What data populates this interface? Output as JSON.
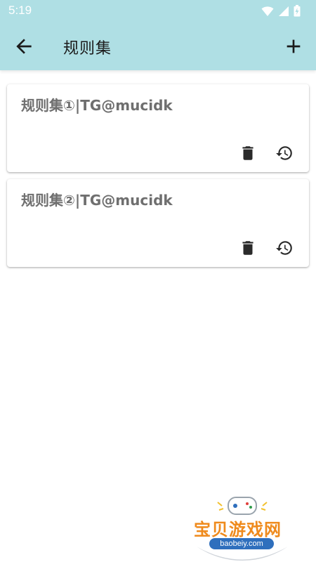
{
  "status_bar": {
    "time": "5:19",
    "icons": [
      "wifi-icon",
      "signal-icon",
      "battery-icon"
    ]
  },
  "app_bar": {
    "title": "规则集",
    "back_icon": "arrow-back-icon",
    "add_icon": "plus-icon",
    "background": "#afdfe4"
  },
  "rule_sets": [
    {
      "title": "规则集①|TG@mucidk",
      "actions": [
        "delete-icon",
        "history-icon"
      ]
    },
    {
      "title": "规则集②|TG@mucidk",
      "actions": [
        "delete-icon",
        "history-icon"
      ]
    }
  ],
  "watermark": {
    "text": "宝贝游戏网",
    "url": "baobeiy.com"
  }
}
